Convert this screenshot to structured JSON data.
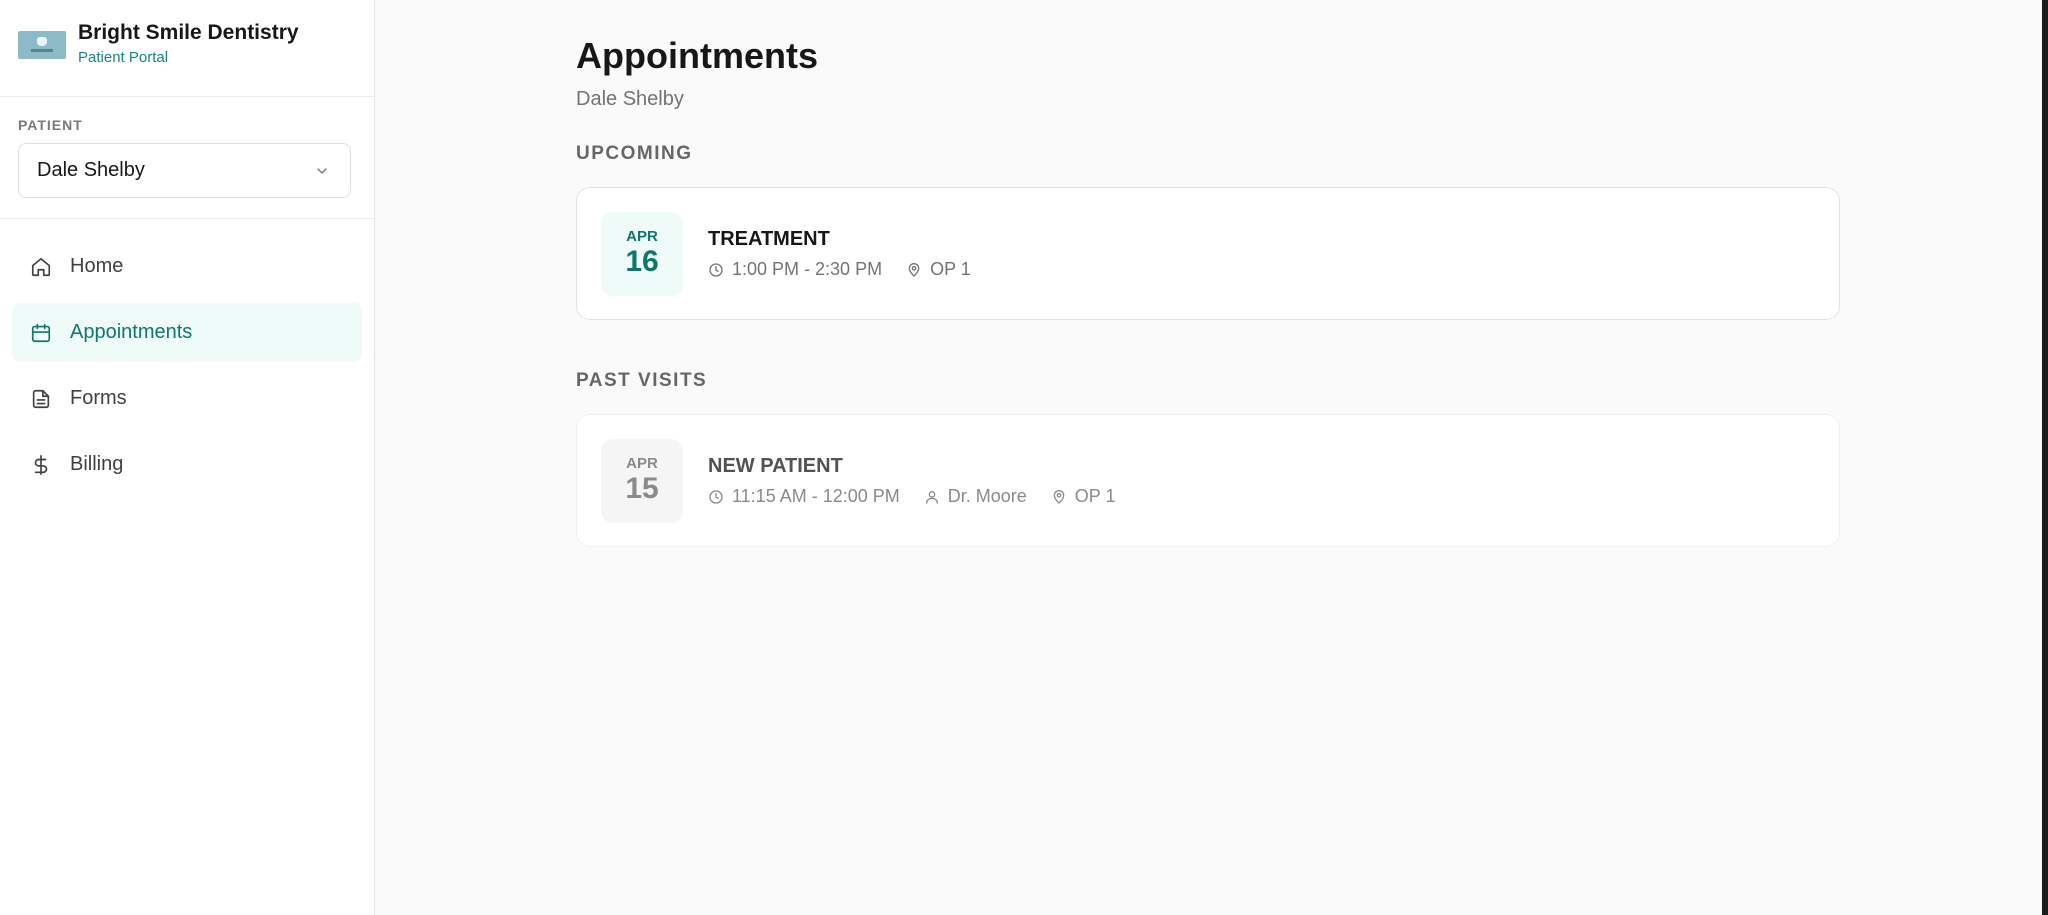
{
  "brand": {
    "name": "Bright Smile Dentistry",
    "subtitle": "Patient Portal"
  },
  "patient": {
    "label": "PATIENT",
    "selected": "Dale Shelby"
  },
  "nav": {
    "items": [
      {
        "label": "Home",
        "icon": "home-icon",
        "active": false
      },
      {
        "label": "Appointments",
        "icon": "calendar-icon",
        "active": true
      },
      {
        "label": "Forms",
        "icon": "document-icon",
        "active": false
      },
      {
        "label": "Billing",
        "icon": "dollar-icon",
        "active": false
      }
    ]
  },
  "page": {
    "title": "Appointments",
    "subtitle": "Dale Shelby"
  },
  "upcoming": {
    "heading": "UPCOMING",
    "appointments": [
      {
        "month": "APR",
        "day": "16",
        "type": "TREATMENT",
        "time": "1:00 PM - 2:30 PM",
        "location": "OP 1"
      }
    ]
  },
  "past": {
    "heading": "PAST VISITS",
    "appointments": [
      {
        "month": "APR",
        "day": "15",
        "type": "NEW PATIENT",
        "time": "11:15 AM - 12:00 PM",
        "provider": "Dr. Moore",
        "location": "OP 1"
      }
    ]
  },
  "colors": {
    "accent": "#0f766e",
    "accent_bg": "#effbf8",
    "brand_sub": "#0f8a80"
  }
}
